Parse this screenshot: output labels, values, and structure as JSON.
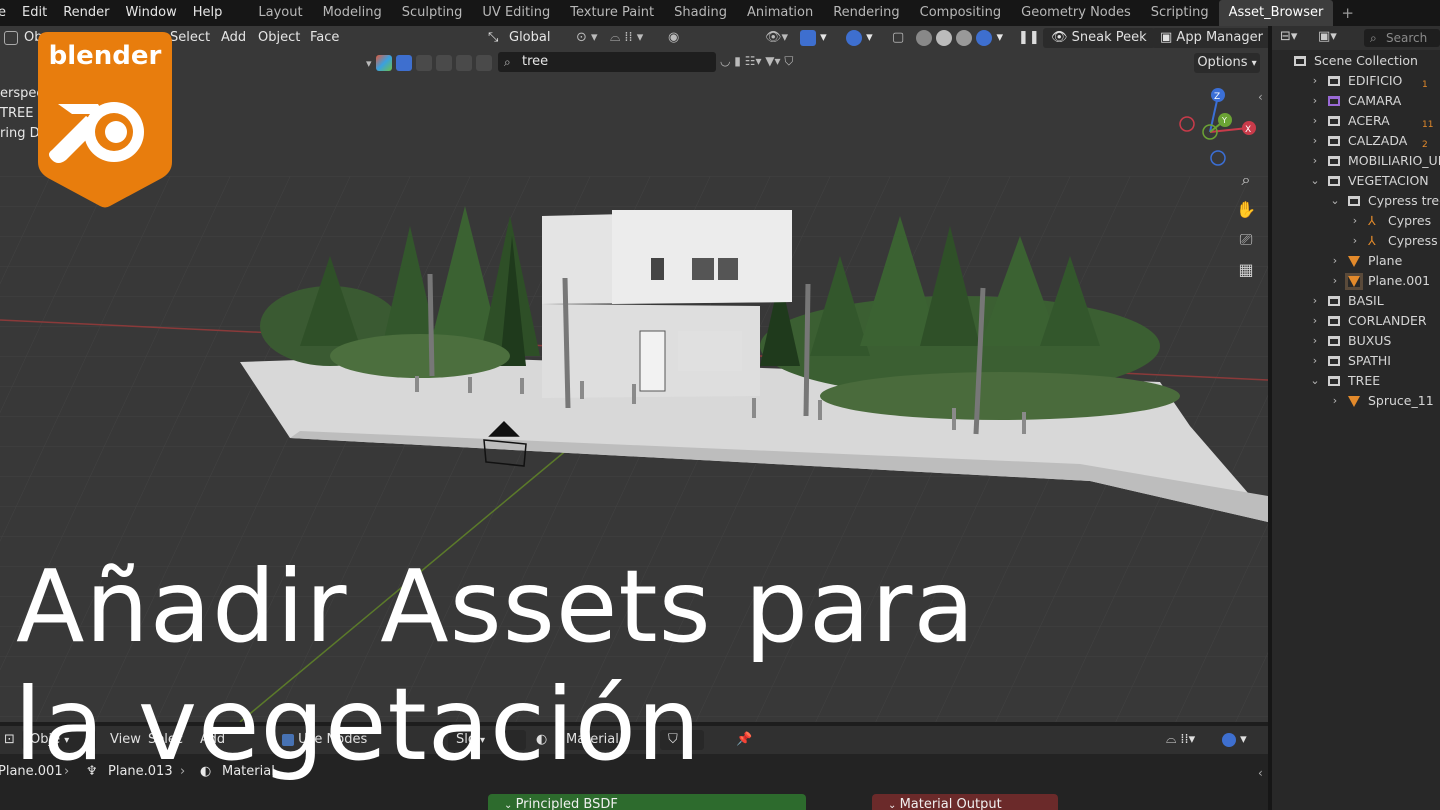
{
  "menu": {
    "items": [
      "e",
      "Edit",
      "Render",
      "Window",
      "Help"
    ]
  },
  "workspaces": {
    "tabs": [
      "Layout",
      "Modeling",
      "Sculpting",
      "UV Editing",
      "Texture Paint",
      "Shading",
      "Animation",
      "Rendering",
      "Compositing",
      "Geometry Nodes",
      "Scripting",
      "Asset_Browser"
    ],
    "active": "Asset_Browser",
    "add_label": "+"
  },
  "viewport": {
    "header": {
      "mode_label": "Ob",
      "select_label": "Select",
      "add_label": "Add",
      "object_label": "Object",
      "face_label": "Face",
      "transform_orientation": "Global",
      "sneak_peek_label": "Sneak Peek",
      "app_manager_label": "App Manager"
    },
    "asset_search": {
      "value": "tree"
    },
    "options_label": "Options",
    "overlay_lines": [
      "erspec",
      "TREE |",
      "ring Do"
    ]
  },
  "logo": {
    "wordmark": "blender"
  },
  "outliner": {
    "search_placeholder": "Search",
    "rows": [
      {
        "label": "Scene Collection",
        "depth": 0,
        "kind": "scene"
      },
      {
        "label": "EDIFICIO",
        "depth": 1,
        "kind": "collection",
        "badge": "1"
      },
      {
        "label": "CAMARA",
        "depth": 1,
        "kind": "collection-purple"
      },
      {
        "label": "ACERA",
        "depth": 1,
        "kind": "collection",
        "badge": "11"
      },
      {
        "label": "CALZADA",
        "depth": 1,
        "kind": "collection",
        "badge": "2"
      },
      {
        "label": "MOBILIARIO_URB",
        "depth": 1,
        "kind": "collection"
      },
      {
        "label": "VEGETACION",
        "depth": 1,
        "kind": "collection",
        "open": true
      },
      {
        "label": "Cypress tree",
        "depth": 2,
        "kind": "collection",
        "open": true
      },
      {
        "label": "Cypres",
        "depth": 3,
        "kind": "empty"
      },
      {
        "label": "Cypress tre",
        "depth": 3,
        "kind": "empty"
      },
      {
        "label": "Plane",
        "depth": 2,
        "kind": "mesh"
      },
      {
        "label": "Plane.001",
        "depth": 2,
        "kind": "mesh-selected"
      },
      {
        "label": "BASIL",
        "depth": 1,
        "kind": "collection"
      },
      {
        "label": "CORLANDER",
        "depth": 1,
        "kind": "collection"
      },
      {
        "label": "BUXUS",
        "depth": 1,
        "kind": "collection"
      },
      {
        "label": "SPATHI",
        "depth": 1,
        "kind": "collection"
      },
      {
        "label": "TREE",
        "depth": 1,
        "kind": "collection",
        "open": true
      },
      {
        "label": "Spruce_11",
        "depth": 2,
        "kind": "mesh"
      }
    ]
  },
  "node_editor": {
    "header": {
      "object_label": "Obje",
      "view_label": "View",
      "select_label": "Selec",
      "add_label": "Add",
      "use_nodes_label": "Use Nodes",
      "slot_label": "Slo",
      "material_label": "Material"
    },
    "breadcrumb": [
      "Plane.001",
      "Plane.013",
      "Material"
    ],
    "nodes": [
      {
        "label": "Principled BSDF",
        "color": "#2d6b2d"
      },
      {
        "label": "Material Output",
        "color": "#6b2a2a"
      }
    ]
  },
  "title": {
    "line1": "Añadir Assets para",
    "line2": "la vegetación"
  },
  "colors": {
    "accent_orange": "#e87d0d",
    "active_blue": "#4772b3"
  }
}
